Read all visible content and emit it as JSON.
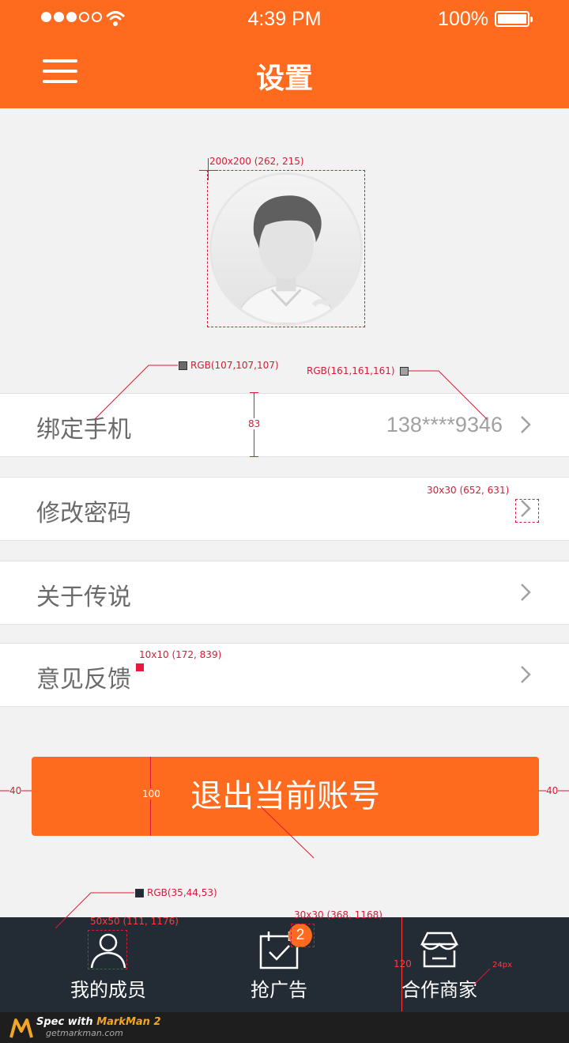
{
  "status_bar": {
    "time": "4:39 PM",
    "battery": "100%",
    "signal_filled": 3,
    "signal_total": 5
  },
  "header": {
    "title": "设置"
  },
  "rows": [
    {
      "label": "绑定手机",
      "value": "138****9346"
    },
    {
      "label": "修改密码",
      "value": ""
    },
    {
      "label": "关于传说",
      "value": ""
    },
    {
      "label": "意见反馈",
      "value": ""
    }
  ],
  "logout": {
    "label": "退出当前账号"
  },
  "tabs": [
    {
      "label": "我的成员",
      "icon": "user-icon"
    },
    {
      "label": "抢广告",
      "icon": "calendar-check-icon",
      "badge": "2"
    },
    {
      "label": "合作商家",
      "icon": "store-icon"
    }
  ],
  "footer": {
    "brand": "Spec with",
    "product": "MarkMan 2",
    "url": "getmarkman.com"
  },
  "annotations": {
    "avatar": "200x200 (262, 215)",
    "label_color": "RGB(107,107,107)",
    "value_color": "RGB(161,161,161)",
    "row_height": "83",
    "chevron": "30x30 (652, 631)",
    "dot": "10x10 (172, 839)",
    "margin_left": "40",
    "margin_right": "40",
    "button_height": "100",
    "tabbar_color": "RGB(35,44,53)",
    "tab_icon": "50x50 (111, 1176)",
    "tab_icon2": "30x30 (368, 1168)",
    "tabbar_height": "120",
    "font_size": "24px"
  },
  "colors": {
    "accent": "#fe6b1f",
    "tabbar": "#232c35",
    "label": "#6b6b6b",
    "value": "#a1a1a1"
  }
}
